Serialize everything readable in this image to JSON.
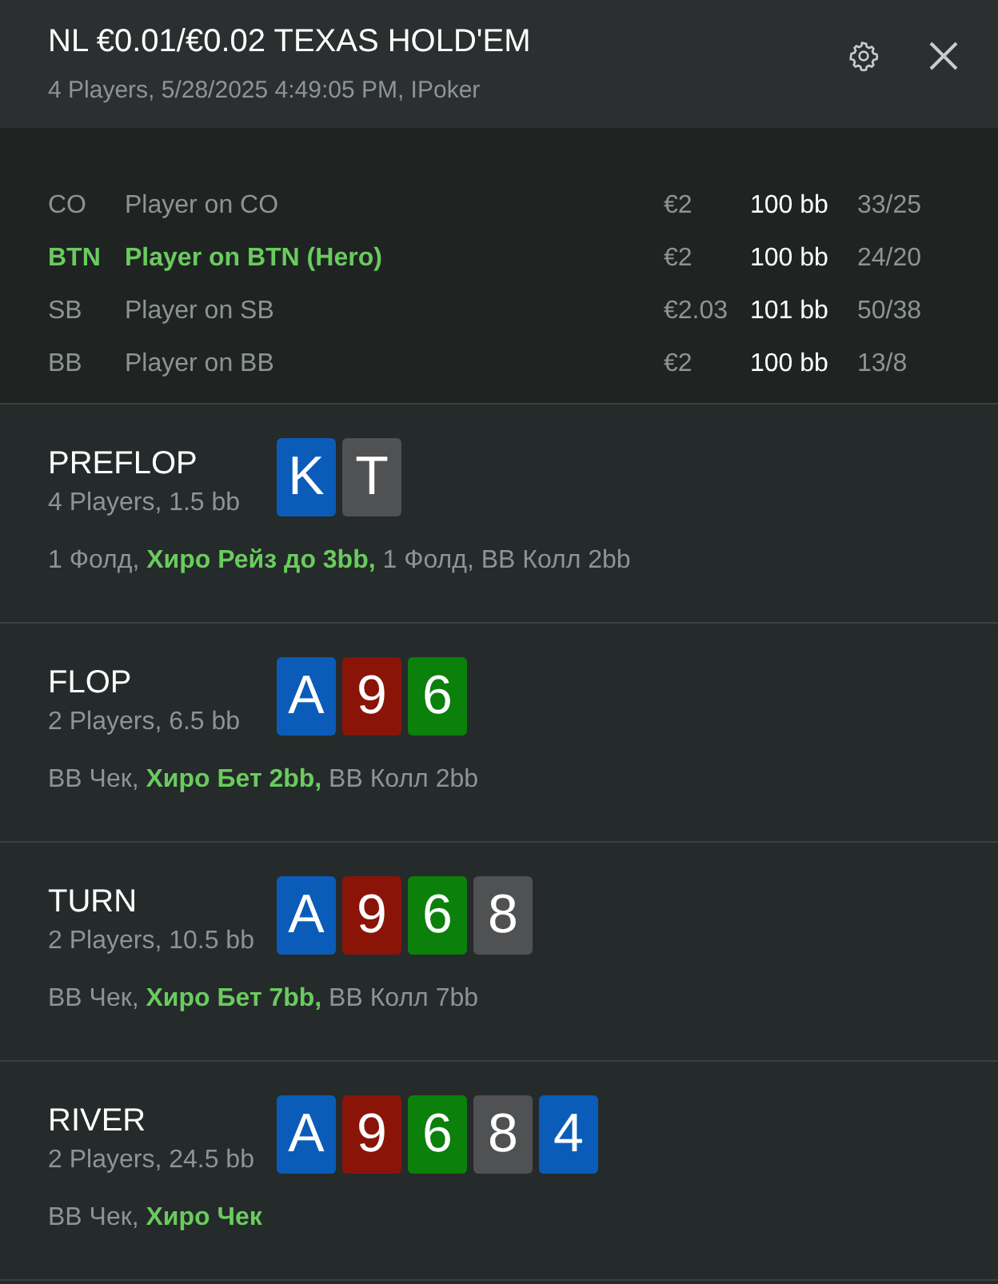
{
  "header": {
    "title": "NL €0.01/€0.02 TEXAS HOLD'EM",
    "subtitle": "4 Players, 5/28/2025 4:49:05 PM, IPoker"
  },
  "players": [
    {
      "position": "CO",
      "name": "Player on CO",
      "stack": "€2",
      "bb": "100 bb",
      "stats": "33/25",
      "hero": false
    },
    {
      "position": "BTN",
      "name": "Player on BTN (Hero)",
      "stack": "€2",
      "bb": "100 bb",
      "stats": "24/20",
      "hero": true
    },
    {
      "position": "SB",
      "name": "Player on SB",
      "stack": "€2.03",
      "bb": "101 bb",
      "stats": "50/38",
      "hero": false
    },
    {
      "position": "BB",
      "name": "Player on BB",
      "stack": "€2",
      "bb": "100 bb",
      "stats": "13/8",
      "hero": false
    }
  ],
  "streets": [
    {
      "name": "PREFLOP",
      "info": "4 Players, 1.5 bb",
      "cards": [
        {
          "rank": "K",
          "color": "#0b5cb8"
        },
        {
          "rank": "T",
          "color": "#505152"
        }
      ],
      "actions": "1 Фолд, **Хиро Рейз до 3bb,** 1 Фолд, BB Колл 2bb"
    },
    {
      "name": "FLOP",
      "info": "2 Players, 6.5 bb",
      "cards": [
        {
          "rank": "A",
          "color": "#0b5cb8"
        },
        {
          "rank": "9",
          "color": "#8b1409"
        },
        {
          "rank": "6",
          "color": "#0b800b"
        }
      ],
      "actions": "BB Чек, **Хиро Бет 2bb,** BB Колл 2bb"
    },
    {
      "name": "TURN",
      "info": "2 Players, 10.5 bb",
      "cards": [
        {
          "rank": "A",
          "color": "#0b5cb8"
        },
        {
          "rank": "9",
          "color": "#8b1409"
        },
        {
          "rank": "6",
          "color": "#0b800b"
        },
        {
          "rank": "8",
          "color": "#505152"
        }
      ],
      "actions": "BB Чек, **Хиро Бет 7bb,** BB Колл 7bb"
    },
    {
      "name": "RIVER",
      "info": "2 Players, 24.5 bb",
      "cards": [
        {
          "rank": "A",
          "color": "#0b5cb8"
        },
        {
          "rank": "9",
          "color": "#8b1409"
        },
        {
          "rank": "6",
          "color": "#0b800b"
        },
        {
          "rank": "8",
          "color": "#505152"
        },
        {
          "rank": "4",
          "color": "#0b5cb8"
        }
      ],
      "actions": "BB Чек, **Хиро Чек**"
    }
  ]
}
